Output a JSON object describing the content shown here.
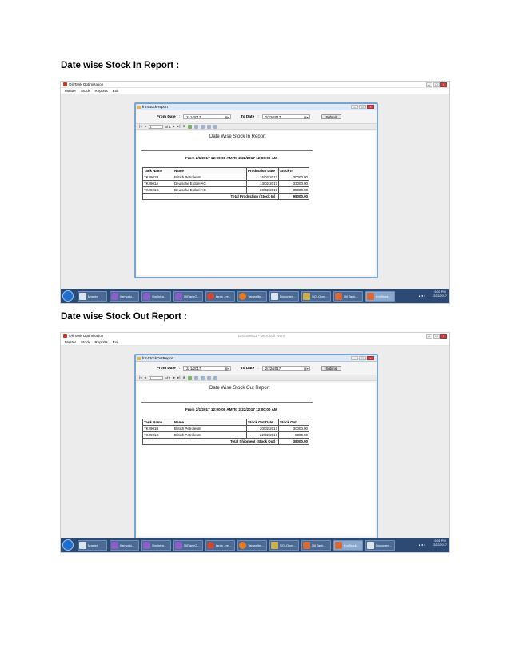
{
  "section_in": {
    "heading": "Date wise Stock In Report :",
    "app_title": "Oil Tank Optimization",
    "menu": [
      "Master",
      "Stock",
      "Reports",
      "Exit"
    ],
    "form_title": "frmStockReport",
    "from_label": "From Date",
    "from_value": "2/ 1/2017",
    "to_label": "To Date",
    "to_value": "2/22/2017",
    "submit_label": "Submit",
    "toolbar": {
      "page": "1",
      "of": "of 1"
    },
    "report_title": "Date Wise Stock In Report",
    "range_text": "From 2/1/2017 12:00:00 AM To 2/22/2017 12:00:00 AM",
    "columns": [
      "Tank Name",
      "Name",
      "Production Date",
      "Stock In"
    ],
    "rows": [
      [
        "TK2901B",
        "British Petroleum",
        "15/02/2017",
        "30000.00"
      ],
      [
        "TK2901A",
        "Deutsche Erdoel AG",
        "13/02/2017",
        "33000.00"
      ],
      [
        "TK2901C",
        "Deutsche Erdoel AG",
        "20/02/2017",
        "35000.00"
      ]
    ],
    "total_label": "Total Production (Stock In) :",
    "total_value": "98000.00",
    "taskbar": [
      "Master",
      "Ilamvalu...",
      "Gwtinfra...",
      "OilTankO...",
      "taras - re...",
      "Tamanibs...",
      "Documen...",
      "SQLQuer...",
      "Oil Tank...",
      "frmStock..."
    ],
    "clock": {
      "time": "6:03 PM",
      "date": "2/22/2017"
    }
  },
  "section_out": {
    "heading": "Date wise Stock Out Report :",
    "app_title": "Oil Tank Optimization",
    "inactive_title": "Document1 - Microsoft Word",
    "menu": [
      "Master",
      "Stock",
      "Reports",
      "Exit"
    ],
    "form_title": "frmStockOutReport",
    "from_label": "From Date",
    "from_value": "2/ 1/2017",
    "to_label": "To Date",
    "to_value": "2/22/2017",
    "submit_label": "Submit",
    "toolbar": {
      "page": "1",
      "of": "of 1"
    },
    "report_title": "Date Wise Stock Out Report",
    "range_text": "From 2/1/2017 12:00:00 AM To 2/22/2017 12:00:00 AM",
    "columns": [
      "Tank Name",
      "Name",
      "Stock Out Date",
      "Stock Out"
    ],
    "rows": [
      [
        "TK2901B",
        "British Petroleum",
        "20/02/2017",
        "30000.00"
      ],
      [
        "TK2901C",
        "British Petroleum",
        "22/02/2017",
        "8000.00"
      ]
    ],
    "total_label": "Total Shipment (Stock Out) :",
    "total_value": "38000.00",
    "taskbar": [
      "Master",
      "Ilamvalu...",
      "Gwtinfra...",
      "OilTankO...",
      "taras - re...",
      "Tamanibs...",
      "SQLQuer...",
      "Oil Tank...",
      "frmStock...",
      "Documen..."
    ],
    "clock": {
      "time": "6:08 PM",
      "date": "2/22/2017"
    }
  }
}
